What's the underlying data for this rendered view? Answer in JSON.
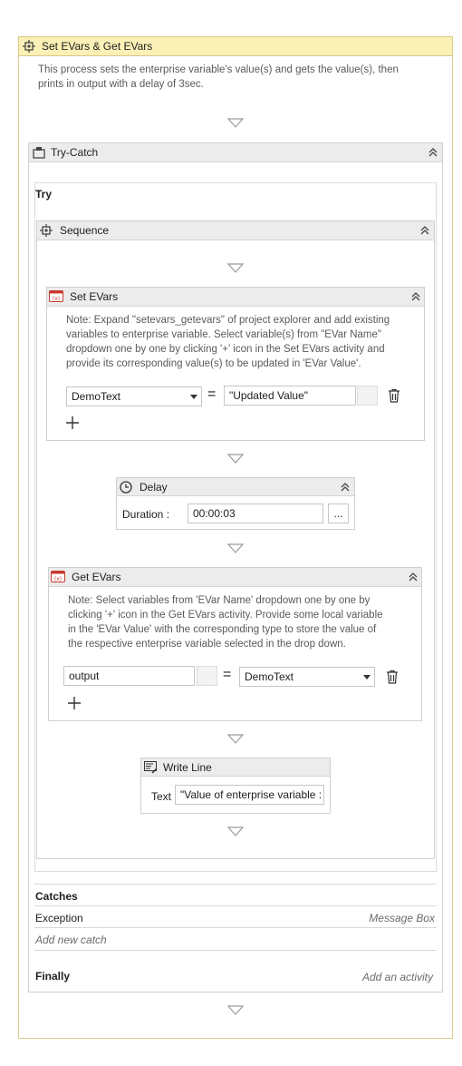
{
  "workflow": {
    "title": "Set EVars & Get EVars",
    "description_lines": [
      "This process sets the enterprise variable's value(s) and gets the value(s), then",
      "prints in output with a delay of 3sec."
    ]
  },
  "trycatch": {
    "title": "Try-Catch",
    "try_label": "Try",
    "catches_label": "Catches",
    "exception_label": "Exception",
    "exception_action": "Message Box",
    "add_catch": "Add new catch",
    "finally_label": "Finally",
    "finally_action": "Add an activity"
  },
  "sequence": {
    "title": "Sequence"
  },
  "set_evars": {
    "title": "Set EVars",
    "note_lines": [
      "Note: Expand \"setevars_getevars\" of project explorer and add existing",
      "variables to enterprise variable. Select variable(s) from \"EVar Name\"",
      "dropdown one by one by clicking '+' icon in the Set EVars activity and",
      "provide its corresponding value(s) to be updated in 'EVar Value'."
    ],
    "evar_name": "DemoText",
    "equals": "=",
    "evar_value": "\"Updated Value\""
  },
  "delay": {
    "title": "Delay",
    "duration_label": "Duration :",
    "duration_value": "00:00:03",
    "browse_label": "..."
  },
  "get_evars": {
    "title": "Get EVars",
    "note_lines": [
      "Note: Select variables from 'EVar Name' dropdown one by one by",
      "clicking '+' icon in the Get EVars activity. Provide some local variable",
      "in the 'EVar Value' with the corresponding type to store the value of",
      "the respective enterprise variable selected in the drop down."
    ],
    "local_var": "output",
    "equals": "=",
    "evar_name": "DemoText"
  },
  "write_line": {
    "title": "Write Line",
    "text_label": "Text",
    "text_value": "\"Value of enterprise variable :"
  },
  "colors": {
    "header_yellow": "#fbf0b6",
    "border_yellow": "#d8c88a",
    "activity_bar": "#ececec",
    "evar_icon_red": "#c8392f"
  }
}
